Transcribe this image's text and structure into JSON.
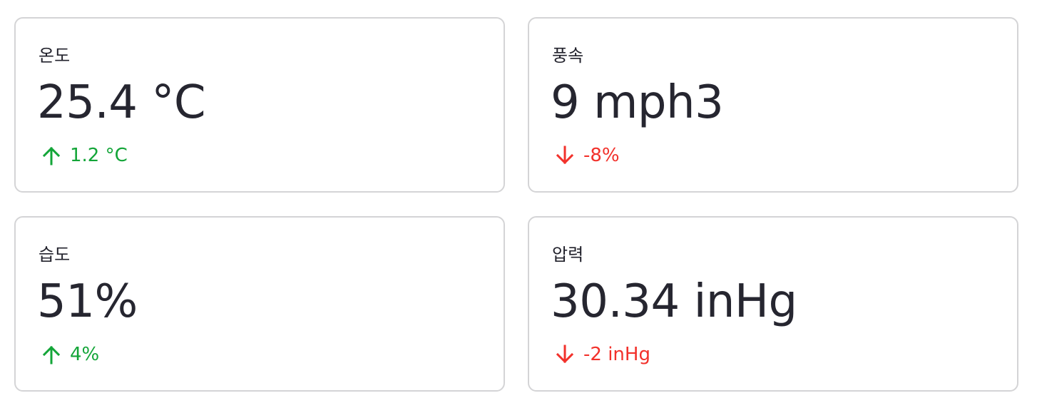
{
  "colors": {
    "up": "#13a538",
    "down": "#f2312b",
    "text": "#22222c",
    "border": "#d4d4d6"
  },
  "cards": [
    {
      "label": "온도",
      "value": "25.4 °C",
      "delta": "1.2 °C",
      "trend": "up",
      "icon": "arrow-up-icon"
    },
    {
      "label": "풍속",
      "value": "9 mph3",
      "delta": "-8%",
      "trend": "down",
      "icon": "arrow-down-icon"
    },
    {
      "label": "습도",
      "value": "51%",
      "delta": "4%",
      "trend": "up",
      "icon": "arrow-up-icon"
    },
    {
      "label": "압력",
      "value": "30.34 inHg",
      "delta": "-2 inHg",
      "trend": "down",
      "icon": "arrow-down-icon"
    }
  ]
}
